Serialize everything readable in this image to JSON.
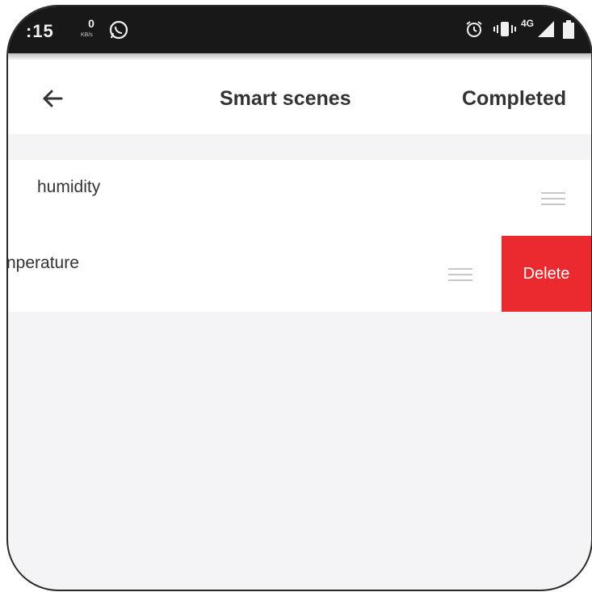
{
  "status_bar": {
    "time": ":15",
    "net_speed_value": "0",
    "net_speed_unit": "KB/s",
    "network_type": "4G",
    "icons": [
      "whatsapp-icon",
      "alarm-icon",
      "vibrate-icon",
      "signal-icon",
      "battery-icon"
    ]
  },
  "header": {
    "title": "Smart scenes",
    "completed_label": "Completed",
    "back_icon": "arrow-left-icon"
  },
  "scenes": [
    {
      "label": "humidity"
    },
    {
      "label": "nperature",
      "delete_label": "Delete"
    }
  ],
  "colors": {
    "accent_delete": "#ea2a2e",
    "background": "#f4f4f6",
    "text": "#333333",
    "status_bar": "#181818"
  }
}
